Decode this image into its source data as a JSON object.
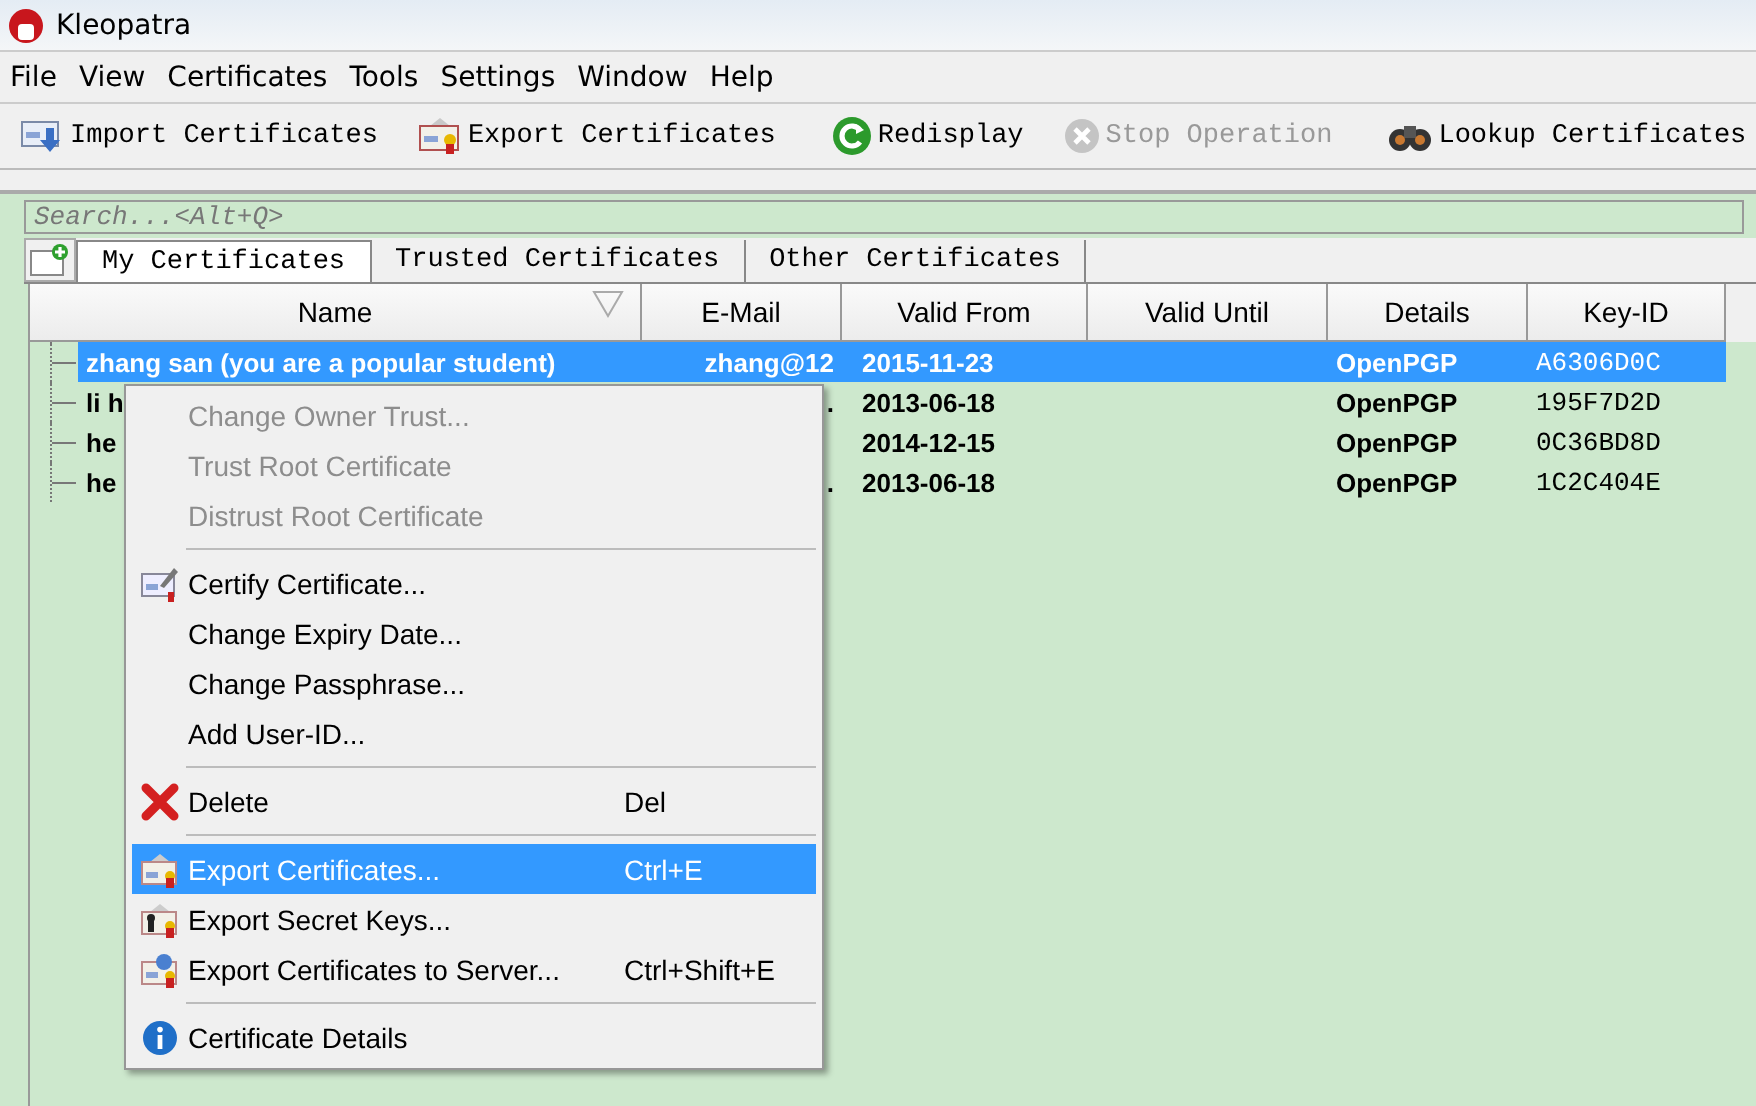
{
  "window": {
    "title": "Kleopatra"
  },
  "menubar": [
    "File",
    "View",
    "Certificates",
    "Tools",
    "Settings",
    "Window",
    "Help"
  ],
  "toolbar": [
    {
      "kind": "button",
      "label": "Import Certificates",
      "disabled": false
    },
    {
      "kind": "button",
      "label": "Export Certificates",
      "disabled": false
    },
    {
      "kind": "separator"
    },
    {
      "kind": "button",
      "label": "Redisplay",
      "disabled": false
    },
    {
      "kind": "button",
      "label": "Stop Operation",
      "disabled": true
    },
    {
      "kind": "separator"
    },
    {
      "kind": "button",
      "label": "Lookup Certificates",
      "disabled": false
    }
  ],
  "search": {
    "placeholder": "Search...<Alt+Q>"
  },
  "tabs": [
    {
      "label": "My Certificates",
      "selected": true
    },
    {
      "label": "Trusted Certificates",
      "selected": false
    },
    {
      "label": "Other Certificates",
      "selected": false
    }
  ],
  "table": {
    "columns": [
      "Name",
      "E-Mail",
      "Valid From",
      "Valid Until",
      "Details",
      "Key-ID"
    ],
    "rows": [
      {
        "selected": true,
        "cells": [
          "zhang san (you are a popular student)",
          "zhang@12",
          "2015-11-23",
          "",
          "OpenPGP",
          "A6306D0C"
        ]
      },
      {
        "selected": false,
        "cells": [
          "li h",
          ".",
          "2013-06-18",
          "",
          "OpenPGP",
          "195F7D2D"
        ]
      },
      {
        "selected": false,
        "cells": [
          "he",
          "",
          "2014-12-15",
          "",
          "OpenPGP",
          "0C36BD8D"
        ]
      },
      {
        "selected": false,
        "cells": [
          "he",
          ".",
          "2013-06-18",
          "",
          "OpenPGP",
          "1C2C404E"
        ]
      }
    ]
  },
  "context_menu": [
    {
      "kind": "item",
      "label": "Change Owner Trust...",
      "disabled": true,
      "selected": false
    },
    {
      "kind": "item",
      "label": "Trust Root Certificate",
      "disabled": true,
      "selected": false
    },
    {
      "kind": "item",
      "label": "Distrust Root Certificate",
      "disabled": true,
      "selected": false
    },
    {
      "kind": "separator"
    },
    {
      "kind": "item",
      "label": "Certify Certificate...",
      "disabled": false,
      "selected": false
    },
    {
      "kind": "item",
      "label": "Change Expiry Date...",
      "disabled": false,
      "selected": false
    },
    {
      "kind": "item",
      "label": "Change Passphrase...",
      "disabled": false,
      "selected": false
    },
    {
      "kind": "item",
      "label": "Add User-ID...",
      "disabled": false,
      "selected": false
    },
    {
      "kind": "separator"
    },
    {
      "kind": "item",
      "label": "Delete",
      "shortcut": "Del",
      "disabled": false,
      "selected": false
    },
    {
      "kind": "separator"
    },
    {
      "kind": "item",
      "label": "Export Certificates...",
      "shortcut": "Ctrl+E",
      "disabled": false,
      "selected": true
    },
    {
      "kind": "item",
      "label": "Export Secret Keys...",
      "disabled": false,
      "selected": false
    },
    {
      "kind": "item",
      "label": "Export Certificates to Server...",
      "shortcut": "Ctrl+Shift+E",
      "disabled": false,
      "selected": false
    },
    {
      "kind": "separator"
    },
    {
      "kind": "item",
      "label": "Certificate Details",
      "disabled": false,
      "selected": false
    }
  ]
}
